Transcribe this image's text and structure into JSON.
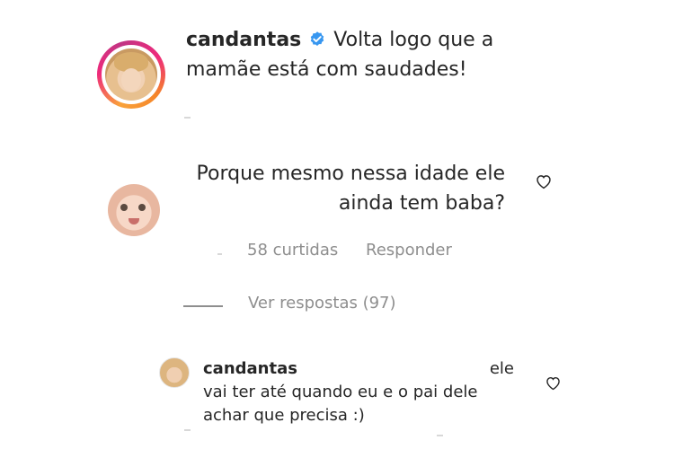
{
  "caption": {
    "username": "candantas",
    "text": "Volta logo que a mamãe está com saudades!",
    "verified_icon": "verified-badge-icon",
    "accent_color": "#3897f0"
  },
  "comment": {
    "text": "Porque mesmo nessa idade ele ainda tem baba?",
    "likes": "58 curtidas",
    "reply_label": "Responder",
    "view_replies": "Ver respostas (97)"
  },
  "reply": {
    "username": "candantas",
    "text_start": "ele",
    "text_rest": "vai ter até quando eu e o pai dele achar que precisa :)"
  }
}
